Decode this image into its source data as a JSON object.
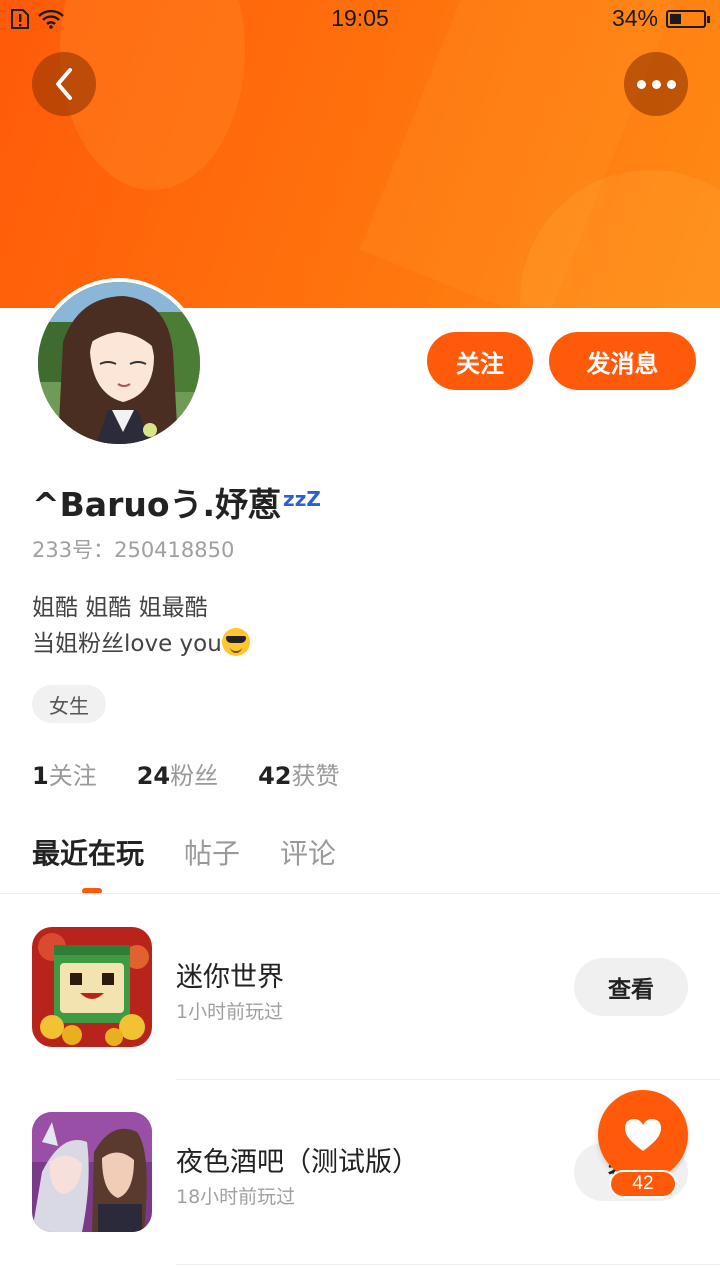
{
  "status_bar": {
    "time": "19:05",
    "battery_percent": "34%",
    "battery_level": 0.34
  },
  "header": {
    "back_icon": "chevron-left-icon",
    "more_icon": "more-dots-icon",
    "banner_color": "#ff6a0c"
  },
  "profile": {
    "username": "^Baruoう.妤蒽",
    "username_suffix": "zzZ",
    "uid_label": "233号：",
    "uid": "250418850",
    "bio_line1": "姐酷 姐酷 姐最酷",
    "bio_line2": "当姐粉丝love you",
    "bio_emoji": "sunglasses-emoji",
    "gender": "女生"
  },
  "actions": {
    "follow_label": "关注",
    "message_label": "发消息",
    "accent_color": "#ff5a0a"
  },
  "stats": [
    {
      "value": "1",
      "label": "关注"
    },
    {
      "value": "24",
      "label": "粉丝"
    },
    {
      "value": "42",
      "label": "获赞"
    }
  ],
  "tabs": [
    {
      "label": "最近在玩",
      "active": true
    },
    {
      "label": "帖子",
      "active": false
    },
    {
      "label": "评论",
      "active": false
    }
  ],
  "games": [
    {
      "name": "迷你世界",
      "played": "1小时前玩过",
      "button": "查看"
    },
    {
      "name": "夜色酒吧（测试版）",
      "played": "18小时前玩过",
      "button": "查看"
    }
  ],
  "fab": {
    "icon": "heart-icon",
    "count": "42"
  }
}
